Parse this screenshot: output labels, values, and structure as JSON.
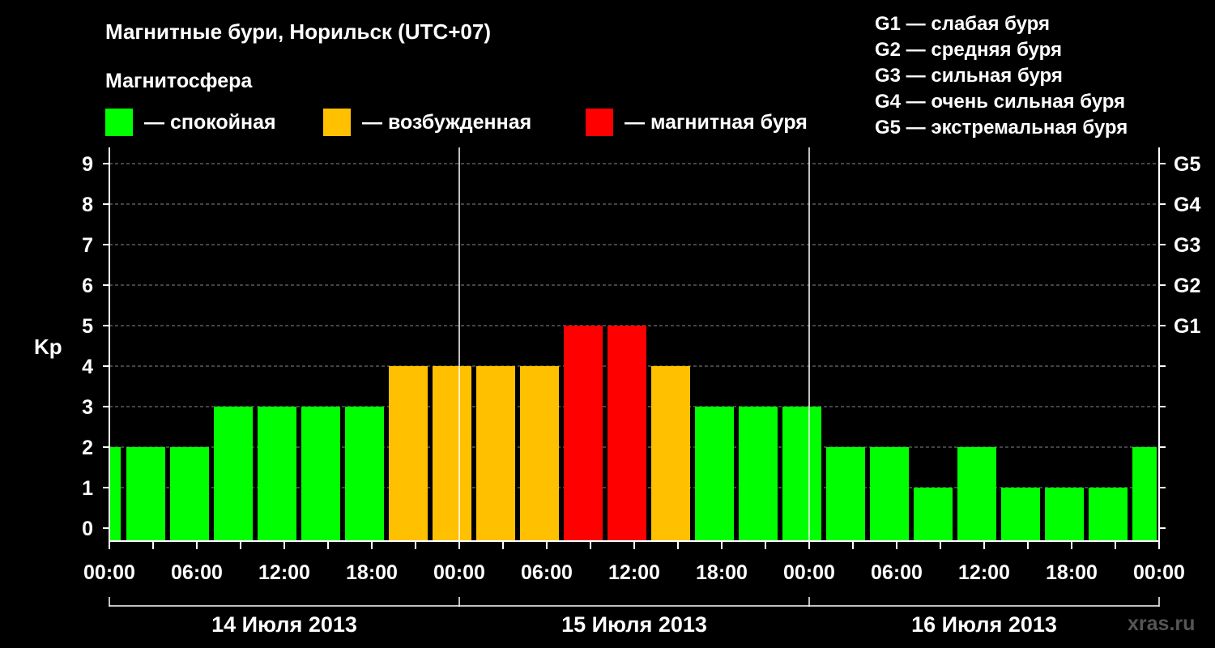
{
  "header": {
    "title": "Магнитные бури, Норильск (UTC+07)",
    "subtitle": "Магнитосфера"
  },
  "legend": [
    {
      "label": "— спокойная",
      "color": "#00ff00"
    },
    {
      "label": "— возбужденная",
      "color": "#ffc000"
    },
    {
      "label": "— магнитная буря",
      "color": "#ff0000"
    }
  ],
  "storm_scale": [
    "G1 — слабая буря",
    "G2 — средняя буря",
    "G3 — сильная буря",
    "G4 — очень сильная буря",
    "G5 — экстремальная буря"
  ],
  "watermark": "xras.ru",
  "chart_data": {
    "type": "bar",
    "ylabel": "Kp",
    "ylim": [
      0,
      9
    ],
    "y_ticks": [
      "0",
      "1",
      "2",
      "3",
      "4",
      "5",
      "6",
      "7",
      "8",
      "9"
    ],
    "right_ticks": [
      {
        "value": 5,
        "label": "G1"
      },
      {
        "value": 6,
        "label": "G2"
      },
      {
        "value": 7,
        "label": "G3"
      },
      {
        "value": 8,
        "label": "G4"
      },
      {
        "value": 9,
        "label": "G5"
      }
    ],
    "x_tick_labels": [
      "00:00",
      "06:00",
      "12:00",
      "18:00",
      "00:00",
      "06:00",
      "12:00",
      "18:00",
      "00:00",
      "06:00",
      "12:00",
      "18:00",
      "00:00"
    ],
    "day_labels": [
      "14 Июля 2013",
      "15 Июля 2013",
      "16 Июля 2013"
    ],
    "grid": "dashed horizontal",
    "bars": [
      {
        "start_hour": 0,
        "end_hour": 1,
        "value": 2,
        "level": "quiet"
      },
      {
        "start_hour": 1,
        "end_hour": 4,
        "value": 2,
        "level": "quiet"
      },
      {
        "start_hour": 4,
        "end_hour": 7,
        "value": 2,
        "level": "quiet"
      },
      {
        "start_hour": 7,
        "end_hour": 10,
        "value": 3,
        "level": "quiet"
      },
      {
        "start_hour": 10,
        "end_hour": 13,
        "value": 3,
        "level": "quiet"
      },
      {
        "start_hour": 13,
        "end_hour": 16,
        "value": 3,
        "level": "quiet"
      },
      {
        "start_hour": 16,
        "end_hour": 19,
        "value": 3,
        "level": "quiet"
      },
      {
        "start_hour": 19,
        "end_hour": 22,
        "value": 4,
        "level": "active"
      },
      {
        "start_hour": 22,
        "end_hour": 25,
        "value": 4,
        "level": "active"
      },
      {
        "start_hour": 25,
        "end_hour": 28,
        "value": 4,
        "level": "active"
      },
      {
        "start_hour": 28,
        "end_hour": 31,
        "value": 4,
        "level": "active"
      },
      {
        "start_hour": 31,
        "end_hour": 34,
        "value": 5,
        "level": "storm"
      },
      {
        "start_hour": 34,
        "end_hour": 37,
        "value": 5,
        "level": "storm"
      },
      {
        "start_hour": 37,
        "end_hour": 40,
        "value": 4,
        "level": "active"
      },
      {
        "start_hour": 40,
        "end_hour": 43,
        "value": 3,
        "level": "quiet"
      },
      {
        "start_hour": 43,
        "end_hour": 46,
        "value": 3,
        "level": "quiet"
      },
      {
        "start_hour": 46,
        "end_hour": 49,
        "value": 3,
        "level": "quiet"
      },
      {
        "start_hour": 49,
        "end_hour": 52,
        "value": 2,
        "level": "quiet"
      },
      {
        "start_hour": 52,
        "end_hour": 55,
        "value": 2,
        "level": "quiet"
      },
      {
        "start_hour": 55,
        "end_hour": 58,
        "value": 1,
        "level": "quiet"
      },
      {
        "start_hour": 58,
        "end_hour": 61,
        "value": 2,
        "level": "quiet"
      },
      {
        "start_hour": 61,
        "end_hour": 64,
        "value": 1,
        "level": "quiet"
      },
      {
        "start_hour": 64,
        "end_hour": 67,
        "value": 1,
        "level": "quiet"
      },
      {
        "start_hour": 67,
        "end_hour": 70,
        "value": 1,
        "level": "quiet"
      },
      {
        "start_hour": 70,
        "end_hour": 72,
        "value": 2,
        "level": "quiet"
      }
    ],
    "level_colors": {
      "quiet": "#00ff00",
      "active": "#ffc000",
      "storm": "#ff0000"
    }
  }
}
